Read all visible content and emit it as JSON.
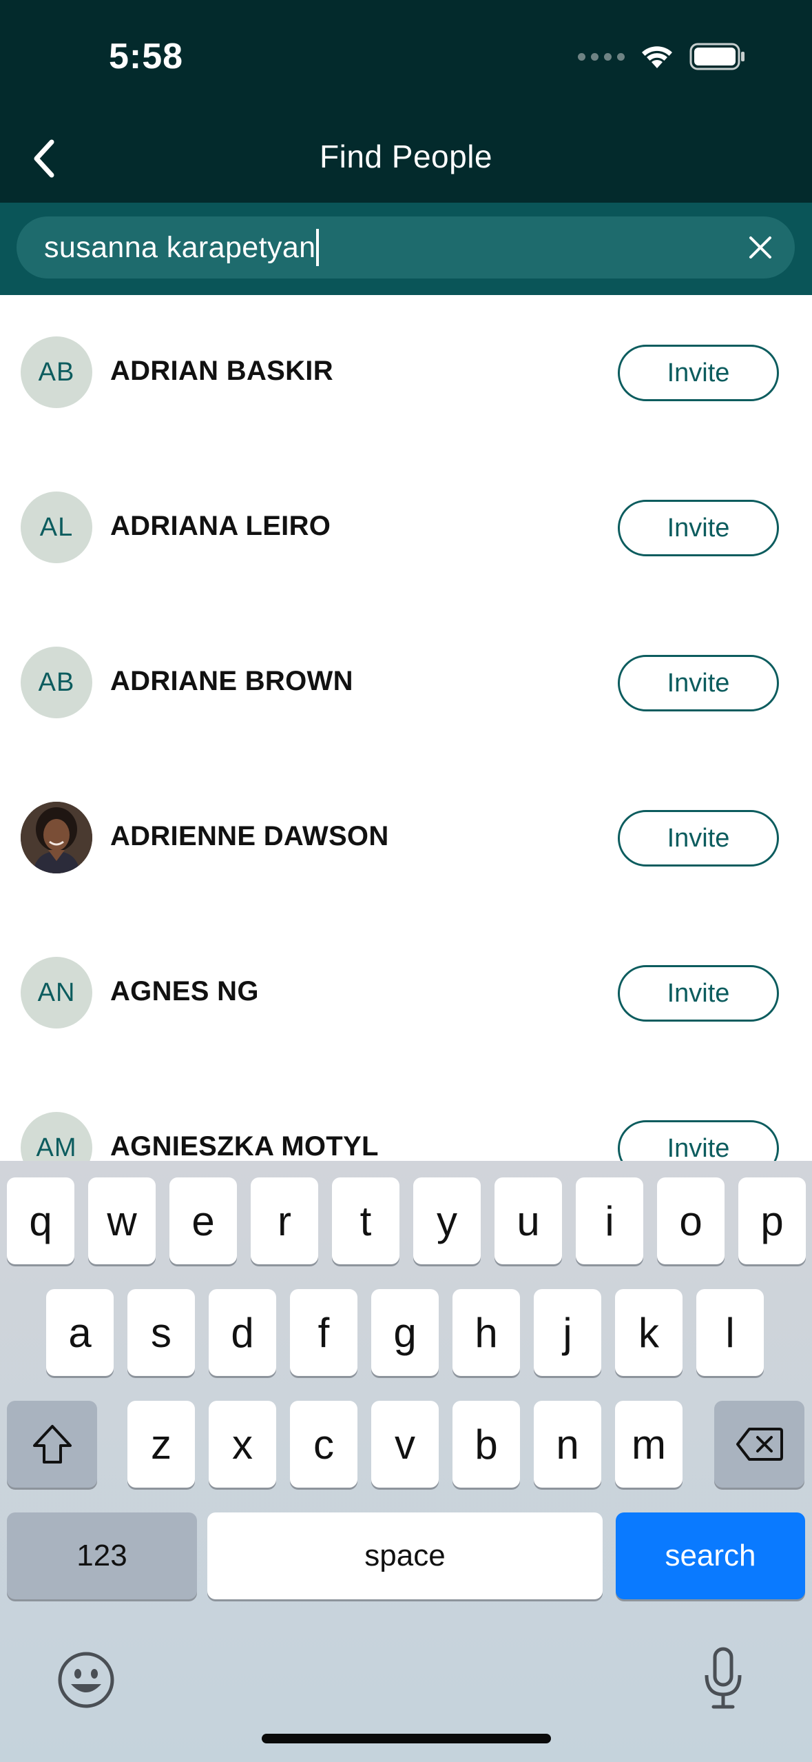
{
  "status_bar": {
    "time": "5:58"
  },
  "nav": {
    "title": "Find People"
  },
  "search": {
    "value": "susanna karapetyan"
  },
  "people": [
    {
      "initials": "AB",
      "name": "ADRIAN BASKIR",
      "action": "Invite",
      "photo": false
    },
    {
      "initials": "AL",
      "name": "ADRIANA LEIRO",
      "action": "Invite",
      "photo": false
    },
    {
      "initials": "AB",
      "name": "ADRIANE BROWN",
      "action": "Invite",
      "photo": false
    },
    {
      "initials": "",
      "name": "ADRIENNE DAWSON",
      "action": "Invite",
      "photo": true
    },
    {
      "initials": "AN",
      "name": "AGNES NG",
      "action": "Invite",
      "photo": false
    },
    {
      "initials": "AM",
      "name": "AGNIESZKA MOTYL",
      "action": "Invite",
      "photo": false
    }
  ],
  "keyboard": {
    "row1": [
      "q",
      "w",
      "e",
      "r",
      "t",
      "y",
      "u",
      "i",
      "o",
      "p"
    ],
    "row2": [
      "a",
      "s",
      "d",
      "f",
      "g",
      "h",
      "j",
      "k",
      "l"
    ],
    "row3": [
      "z",
      "x",
      "c",
      "v",
      "b",
      "n",
      "m"
    ],
    "numbers_label": "123",
    "space_label": "space",
    "search_label": "search"
  },
  "colors": {
    "header_bg": "#032a2c",
    "search_bar_bg": "#0a5558",
    "accent": "#0c5c5e",
    "keyboard_search": "#0a7aff"
  }
}
